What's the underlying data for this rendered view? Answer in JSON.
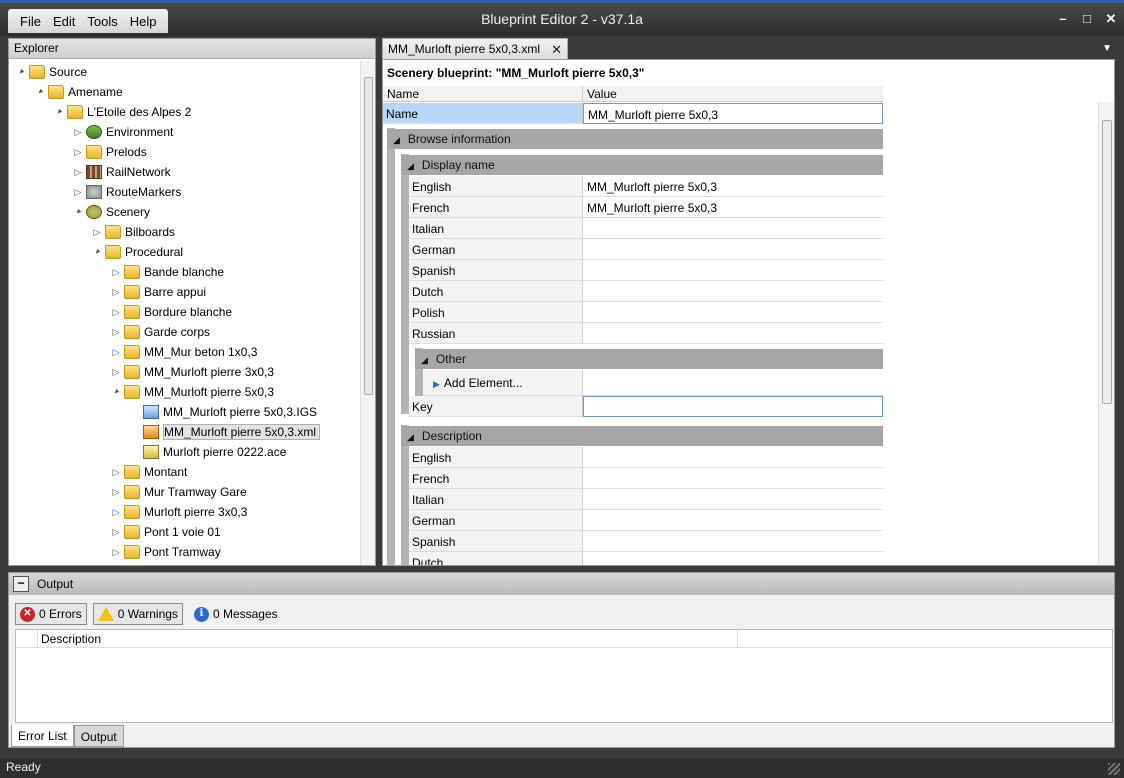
{
  "menu": [
    "File",
    "Edit",
    "Tools",
    "Help"
  ],
  "app_title": "Blueprint Editor 2 - v37.1a",
  "window_controls": {
    "minimize": "–",
    "maximize": "□",
    "close": "✕"
  },
  "explorer": {
    "title": "Explorer",
    "tree": [
      {
        "label": "Source",
        "depth": 0,
        "expander": "▲",
        "icon": "folder"
      },
      {
        "label": "Amename",
        "depth": 1,
        "expander": "▲",
        "icon": "folder"
      },
      {
        "label": "L'Etoile des Alpes 2",
        "depth": 2,
        "expander": "▲",
        "icon": "folder"
      },
      {
        "label": "Environment",
        "depth": 3,
        "expander": "▷",
        "icon": "env"
      },
      {
        "label": "Prelods",
        "depth": 3,
        "expander": "▷",
        "icon": "folder"
      },
      {
        "label": "RailNetwork",
        "depth": 3,
        "expander": "▷",
        "icon": "rail"
      },
      {
        "label": "RouteMarkers",
        "depth": 3,
        "expander": "▷",
        "icon": "route"
      },
      {
        "label": "Scenery",
        "depth": 3,
        "expander": "▲",
        "icon": "scen"
      },
      {
        "label": "Bilboards",
        "depth": 4,
        "expander": "▷",
        "icon": "folder"
      },
      {
        "label": "Procedural",
        "depth": 4,
        "expander": "▲",
        "icon": "folder"
      },
      {
        "label": "Bande blanche",
        "depth": 5,
        "expander": "▷",
        "icon": "folder"
      },
      {
        "label": "Barre appui",
        "depth": 5,
        "expander": "▷",
        "icon": "folder"
      },
      {
        "label": "Bordure blanche",
        "depth": 5,
        "expander": "▷",
        "icon": "folder"
      },
      {
        "label": "Garde corps",
        "depth": 5,
        "expander": "▷",
        "icon": "folder"
      },
      {
        "label": "MM_Mur beton 1x0,3",
        "depth": 5,
        "expander": "▷",
        "icon": "folder"
      },
      {
        "label": "MM_Murloft pierre 3x0,3",
        "depth": 5,
        "expander": "▷",
        "icon": "folder"
      },
      {
        "label": "MM_Murloft pierre 5x0,3",
        "depth": 5,
        "expander": "▲",
        "icon": "folder"
      },
      {
        "label": "MM_Murloft pierre 5x0,3.IGS",
        "depth": 6,
        "expander": "",
        "icon": "igs"
      },
      {
        "label": "MM_Murloft pierre 5x0,3.xml",
        "depth": 6,
        "expander": "",
        "icon": "xml",
        "selected": true
      },
      {
        "label": "Murloft pierre 0222.ace",
        "depth": 6,
        "expander": "",
        "icon": "ace"
      },
      {
        "label": "Montant",
        "depth": 5,
        "expander": "▷",
        "icon": "folder"
      },
      {
        "label": "Mur Tramway Gare",
        "depth": 5,
        "expander": "▷",
        "icon": "folder"
      },
      {
        "label": "Murloft pierre 3x0,3",
        "depth": 5,
        "expander": "▷",
        "icon": "folder"
      },
      {
        "label": "Pont 1 voie 01",
        "depth": 5,
        "expander": "▷",
        "icon": "folder"
      },
      {
        "label": "Pont Tramway",
        "depth": 5,
        "expander": "▷",
        "icon": "folder"
      }
    ]
  },
  "document": {
    "tab_label": "MM_Murloft pierre 5x0,3.xml",
    "tab_close": "✕",
    "tab_dropdown": "▼",
    "title": "Scenery blueprint: \"MM_Murloft pierre 5x0,3\"",
    "columns": {
      "name": "Name",
      "value": "Value"
    },
    "name_row": {
      "label": "Name",
      "value": "MM_Murloft pierre 5x0,3"
    },
    "browse_info": "Browse information",
    "display_name": {
      "title": "Display name",
      "rows": [
        {
          "label": "English",
          "value": "MM_Murloft pierre 5x0,3"
        },
        {
          "label": "French",
          "value": "MM_Murloft pierre 5x0,3"
        },
        {
          "label": "Italian",
          "value": ""
        },
        {
          "label": "German",
          "value": ""
        },
        {
          "label": "Spanish",
          "value": ""
        },
        {
          "label": "Dutch",
          "value": ""
        },
        {
          "label": "Polish",
          "value": ""
        },
        {
          "label": "Russian",
          "value": ""
        }
      ]
    },
    "other": {
      "title": "Other",
      "add_element": "Add Element..."
    },
    "key_row": {
      "label": "Key",
      "value": ""
    },
    "description": {
      "title": "Description",
      "rows": [
        {
          "label": "English",
          "value": ""
        },
        {
          "label": "French",
          "value": ""
        },
        {
          "label": "Italian",
          "value": ""
        },
        {
          "label": "German",
          "value": ""
        },
        {
          "label": "Spanish",
          "value": ""
        },
        {
          "label": "Dutch",
          "value": ""
        }
      ]
    }
  },
  "output": {
    "title": "Output",
    "errors": "0 Errors",
    "warnings": "0 Warnings",
    "messages": "0 Messages",
    "table_header": "Description",
    "tabs": [
      "Error List",
      "Output"
    ]
  },
  "status": "Ready",
  "colors": {
    "accent": "#2a5fa8",
    "selected_row": "#b8d6f5"
  }
}
